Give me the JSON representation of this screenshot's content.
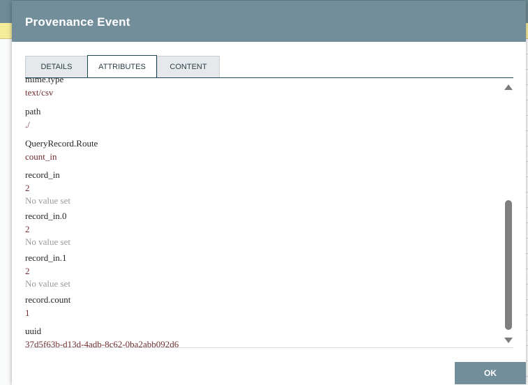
{
  "dialog": {
    "title": "Provenance Event",
    "tabs": [
      {
        "label": "DETAILS",
        "active": false
      },
      {
        "label": "ATTRIBUTES",
        "active": true
      },
      {
        "label": "CONTENT",
        "active": false
      }
    ],
    "attributes": [
      {
        "name": "mime.type",
        "value": "text/csv",
        "previous": ""
      },
      {
        "name": "path",
        "value": "./",
        "previous": ""
      },
      {
        "name": "QueryRecord.Route",
        "value": "count_in",
        "previous": ""
      },
      {
        "name": "record_in",
        "value": "2",
        "previous": "No value set"
      },
      {
        "name": "record_in.0",
        "value": "2",
        "previous": "No value set"
      },
      {
        "name": "record_in.1",
        "value": "2",
        "previous": "No value set"
      },
      {
        "name": "record.count",
        "value": "1",
        "previous": ""
      },
      {
        "name": "uuid",
        "value": "37d5f63b-d13d-4adb-8c62-0ba2abb092d6",
        "previous": ""
      }
    ],
    "ok_label": "OK"
  },
  "colors": {
    "header": "#728e9b",
    "value_text": "#6e2e2e",
    "muted_text": "#9a9a9a",
    "background_highlight": "#f5ec9a"
  }
}
